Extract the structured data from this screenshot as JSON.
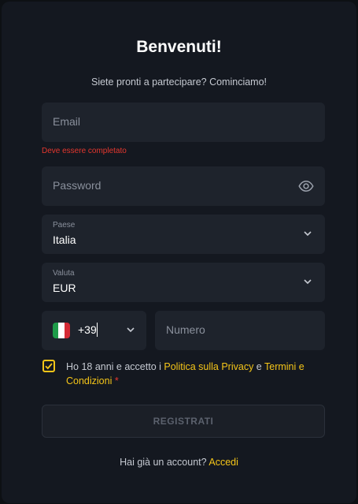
{
  "modal": {
    "title": "Benvenuti!",
    "subtitle": "Siete pronti a partecipare? Cominciamo!"
  },
  "form": {
    "email": {
      "placeholder": "Email",
      "error": "Deve essere completato"
    },
    "password": {
      "placeholder": "Password"
    },
    "country": {
      "label": "Paese",
      "value": "Italia"
    },
    "currency": {
      "label": "Valuta",
      "value": "EUR"
    },
    "phone": {
      "code": "+39",
      "placeholder": "Numero"
    },
    "terms": {
      "prefix": "Ho 18 anni e accetto i ",
      "privacy_link": "Politica sulla Privacy",
      "conjunction": " e ",
      "terms_link": "Termini e Condizioni",
      "required_mark": " *",
      "checked": true
    },
    "submit_label": "REGISTRATI"
  },
  "footer": {
    "question": "Hai già un account? ",
    "login_link": "Accedi"
  },
  "colors": {
    "accent": "#f5c518",
    "error": "#e5372e",
    "field_bg": "#1e232c",
    "modal_bg": "#141820"
  }
}
